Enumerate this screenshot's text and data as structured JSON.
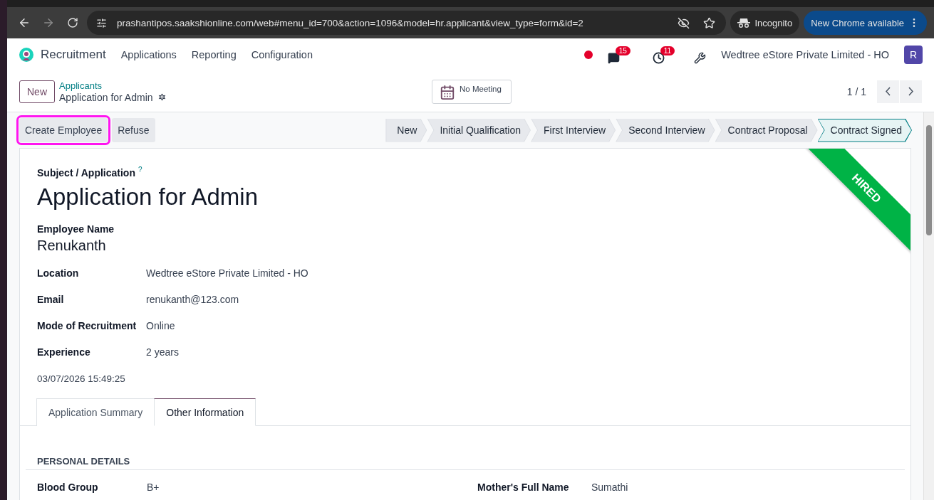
{
  "browser": {
    "url": "prashantipos.saakshionline.com/web#menu_id=700&action=1096&model=hr.applicant&view_type=form&id=2",
    "incognito_label": "Incognito",
    "update_label": "New Chrome available"
  },
  "navbar": {
    "app_name": "Recruitment",
    "menu": [
      "Applications",
      "Reporting",
      "Configuration"
    ],
    "message_count": "15",
    "activity_count": "11",
    "company": "Wedtree eStore Private Limited - HO",
    "avatar_letter": "R"
  },
  "control_panel": {
    "new_button": "New",
    "breadcrumb_parent": "Applicants",
    "breadcrumb_current": "Application for Admin",
    "meeting_button": "No Meeting",
    "pager": "1 / 1"
  },
  "actions": [
    {
      "label": "Create Employee",
      "highlighted": true
    },
    {
      "label": "Refuse",
      "highlighted": false
    }
  ],
  "stages": [
    {
      "label": "New",
      "selected": false
    },
    {
      "label": "Initial Qualification",
      "selected": false
    },
    {
      "label": "First Interview",
      "selected": false
    },
    {
      "label": "Second Interview",
      "selected": false
    },
    {
      "label": "Contract Proposal",
      "selected": false
    },
    {
      "label": "Contract Signed",
      "selected": true
    }
  ],
  "ribbon": "HIRED",
  "form": {
    "subject_label": "Subject / Application",
    "help_mark": "?",
    "title": "Application for Admin",
    "employee_label": "Employee Name",
    "employee_name": "Renukanth",
    "fields": [
      {
        "label": "Location",
        "value": "Wedtree eStore Private Limited - HO"
      },
      {
        "label": "Email",
        "value": "renukanth@123.com"
      },
      {
        "label": "Mode of Recruitment",
        "value": "Online"
      },
      {
        "label": "Experience",
        "value": "2 years"
      }
    ],
    "date": "03/07/2026 15:49:25"
  },
  "tabs": [
    {
      "label": "Application Summary",
      "selected": false
    },
    {
      "label": "Other Information",
      "selected": true
    }
  ],
  "personal_details": {
    "heading": "PERSONAL DETAILS",
    "fields": [
      {
        "label": "Blood Group",
        "value": "B+"
      },
      {
        "label": "Mother's Full Name",
        "value": "Sumathi"
      }
    ]
  }
}
